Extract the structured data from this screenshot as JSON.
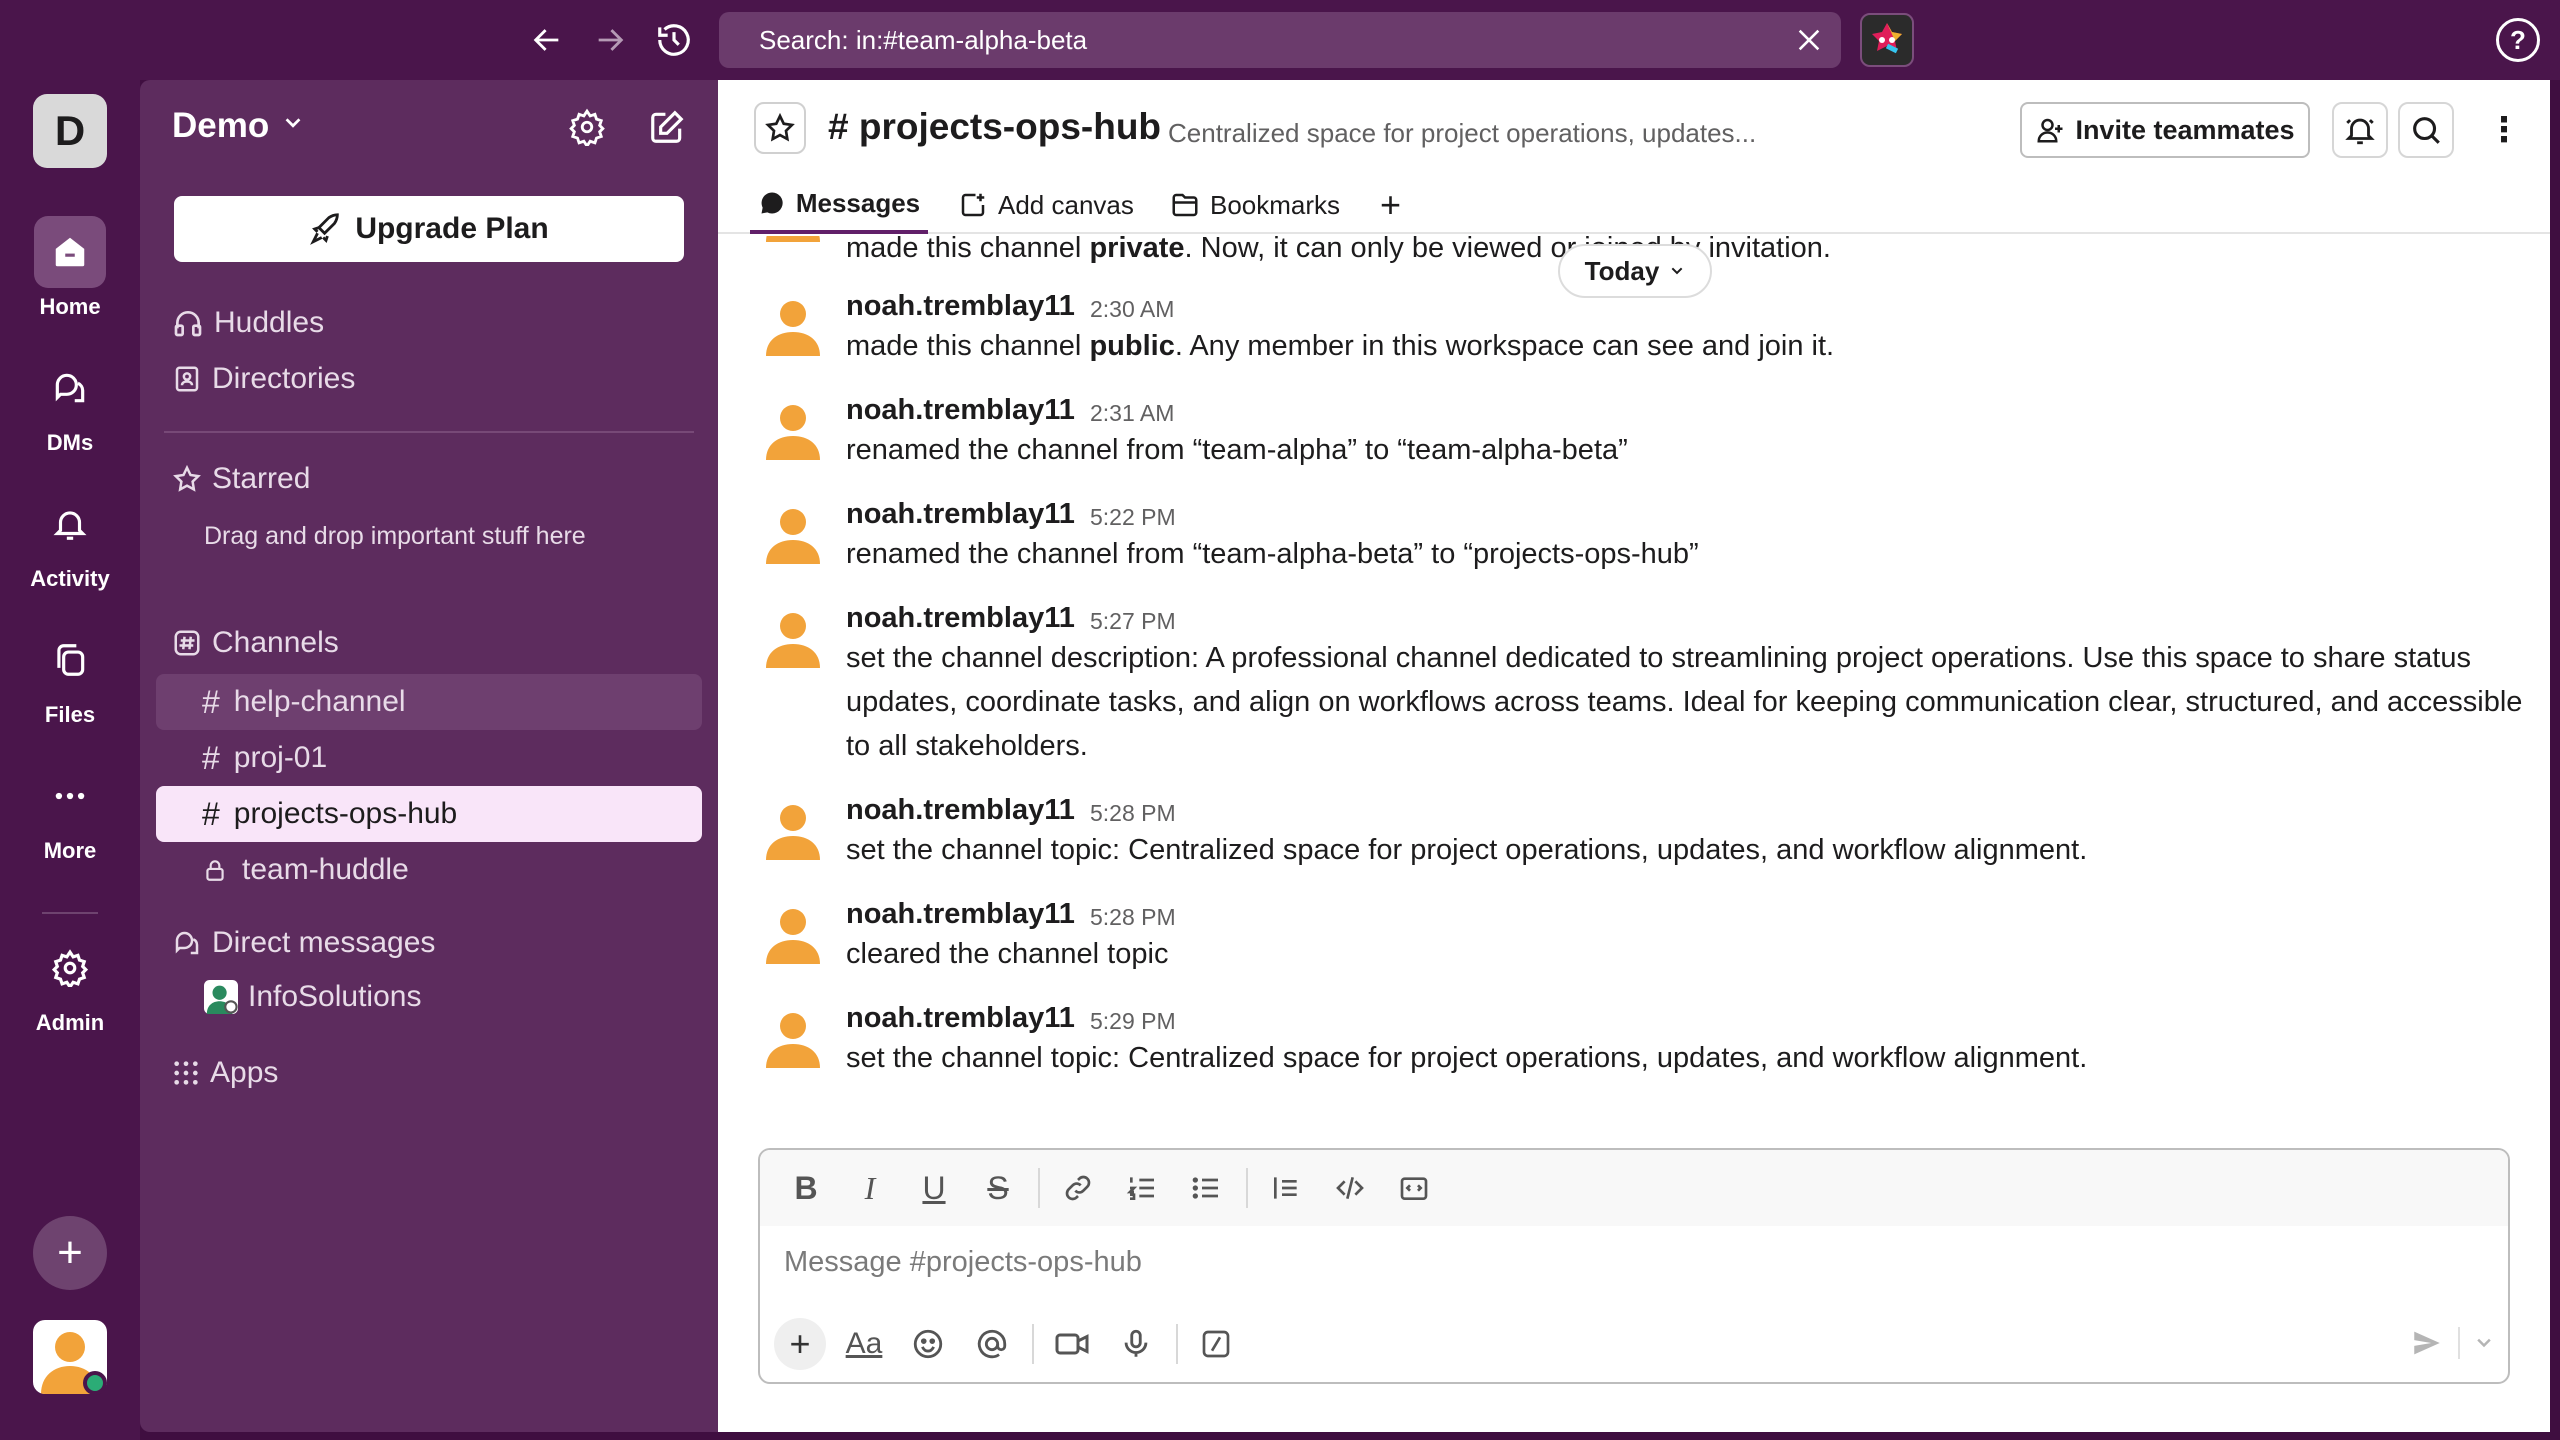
{
  "topbar": {
    "search_text": "Search: in:#team-alpha-beta",
    "help_label": "?"
  },
  "rail": {
    "workspace_initial": "D",
    "items": [
      {
        "label": "Home"
      },
      {
        "label": "DMs"
      },
      {
        "label": "Activity"
      },
      {
        "label": "Files"
      },
      {
        "label": "More"
      },
      {
        "label": "Admin"
      }
    ]
  },
  "sidebar": {
    "workspace_name": "Demo",
    "upgrade_label": "Upgrade Plan",
    "huddles_label": "Huddles",
    "directories_label": "Directories",
    "starred_label": "Starred",
    "starred_hint": "Drag and drop important stuff here",
    "channels_label": "Channels",
    "channels": [
      {
        "name": "help-channel"
      },
      {
        "name": "proj-01"
      },
      {
        "name": "projects-ops-hub"
      },
      {
        "name": "team-huddle"
      }
    ],
    "dm_label": "Direct messages",
    "dms": [
      {
        "name": "InfoSolutions"
      }
    ],
    "apps_label": "Apps"
  },
  "channel": {
    "title": "# projects-ops-hub",
    "description": "Centralized space for project operations, updates...",
    "invite_label": "Invite teammates",
    "tabs": [
      {
        "label": "Messages"
      },
      {
        "label": "Add canvas"
      },
      {
        "label": "Bookmarks"
      }
    ]
  },
  "date_pill": "Today",
  "messages": [
    {
      "pre": "made this channel ",
      "bold": "private",
      "post": ". Now, it can only be viewed or joined by invitation."
    },
    {
      "author": "noah.tremblay11",
      "time": "2:30 AM",
      "pre": "made this channel ",
      "bold": "public",
      "post": ". Any member in this workspace can see and join it."
    },
    {
      "author": "noah.tremblay11",
      "time": "2:31 AM",
      "text": "renamed the channel from “team-alpha” to “team-alpha-beta”"
    },
    {
      "author": "noah.tremblay11",
      "time": "5:22 PM",
      "text": "renamed the channel from “team-alpha-beta” to “projects-ops-hub”"
    },
    {
      "author": "noah.tremblay11",
      "time": "5:27 PM",
      "text": "set the channel description: A professional channel dedicated to streamlining project operations. Use this space to share status updates, coordinate tasks, and align on workflows across teams. Ideal for keeping communication clear, structured, and accessible to all stakeholders."
    },
    {
      "author": "noah.tremblay11",
      "time": "5:28 PM",
      "text": "set the channel topic: Centralized space for project operations, updates, and workflow alignment."
    },
    {
      "author": "noah.tremblay11",
      "time": "5:28 PM",
      "text": "cleared the channel topic"
    },
    {
      "author": "noah.tremblay11",
      "time": "5:29 PM",
      "text": "set the channel topic: Centralized space for project operations, updates, and workflow alignment."
    }
  ],
  "composer": {
    "placeholder": "Message #projects-ops-hub",
    "font_label": "Aa"
  },
  "colors": {
    "aubergine": "#4a154b",
    "sidebar": "#5d2c5e",
    "active_channel": "#f9e5f9",
    "avatar_orange": "#f2a33a",
    "presence_green": "#2bac76"
  }
}
